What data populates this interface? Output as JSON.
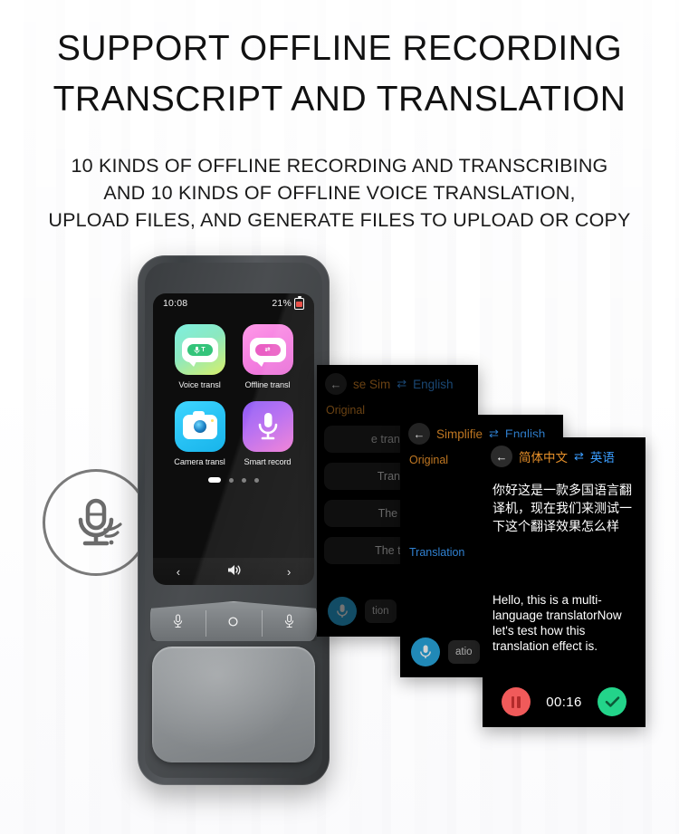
{
  "header": {
    "title_line1": "SUPPORT OFFLINE RECORDING",
    "title_line2": "TRANSCRIPT AND TRANSLATION",
    "subtitle_line1": "10 KINDS OF OFFLINE RECORDING AND TRANSCRIBING",
    "subtitle_line2": "AND 10 KINDS OF OFFLINE VOICE TRANSLATION,",
    "subtitle_line3": "UPLOAD FILES, AND GENERATE FILES TO UPLOAD OR COPY"
  },
  "badge": {
    "icon": "microphone-waves-icon"
  },
  "device": {
    "status": {
      "time": "10:08",
      "battery_percent": "21%",
      "battery_icon": "battery-icon"
    },
    "apps": [
      {
        "label": "Voice transl",
        "icon": "speech-bubble-mic-text-icon",
        "pill_text": "T"
      },
      {
        "label": "Offline transl",
        "icon": "speech-bubble-offline-icon",
        "pill_text": "⇄"
      },
      {
        "label": "Camera transl",
        "icon": "camera-icon"
      },
      {
        "label": "Smart record",
        "icon": "microphone-icon"
      }
    ],
    "pager": {
      "total": 4,
      "active_index": 0
    },
    "nav": {
      "prev": "‹",
      "volume_icon": "speaker-icon",
      "next": "›"
    },
    "hardware_buttons": [
      {
        "icon": "mic-left-button-icon"
      },
      {
        "icon": "home-circle-button-icon"
      },
      {
        "icon": "mic-right-button-icon"
      }
    ]
  },
  "panels": {
    "back_icon": "back-arrow-icon",
    "swap_icon": "swap-languages-icon",
    "panel_a": {
      "lang_source": "se    Sim",
      "lang_target": "English",
      "original_label": "Original",
      "list_items": [
        "e translatio",
        "Translati",
        "The orig",
        "The trans"
      ],
      "mic_icon": "record-mic-icon",
      "chip_text": "tion"
    },
    "panel_b": {
      "lang_source": "Simplifie",
      "lang_target": "English",
      "original_label": "Original",
      "translation_label": "Translation",
      "mic_icon": "record-mic-icon",
      "chip_text": "atio"
    },
    "panel_c": {
      "lang_source": "简体中文",
      "lang_target": "英语",
      "chinese_text": "你好这是一款多国语言翻译机，现在我们来测试一下这个翻译效果怎么样",
      "english_text": "Hello, this is a multi-language translatorNow let's test how this translation effect is.",
      "timer": "00:16",
      "pause_icon": "pause-button-icon",
      "done_icon": "check-confirm-icon"
    }
  },
  "colors": {
    "accent_orange": "#e8912a",
    "accent_blue": "#3b9eff",
    "record_red": "#f05a5a",
    "confirm_green": "#23d48a",
    "mic_blue": "#29a8e0"
  }
}
